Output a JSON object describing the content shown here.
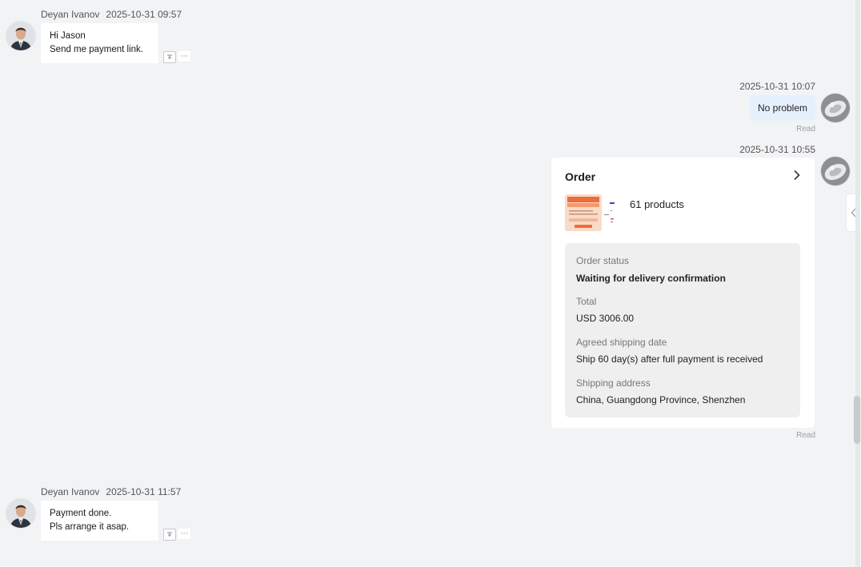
{
  "messages": [
    {
      "sender": "Deyan Ivanov",
      "time": "2025-10-31 09:57",
      "lines": [
        "Hi Jason",
        "Send me payment link."
      ]
    },
    {
      "time": "2025-10-31 10:07",
      "text": "No problem",
      "status": "Read"
    },
    {
      "time": "2025-10-31 10:55",
      "status": "Read",
      "order": {
        "title": "Order",
        "products": "61 products",
        "status_label": "Order status",
        "status_value": "Waiting for delivery confirmation",
        "total_label": "Total",
        "total_value": "USD 3006.00",
        "ship_date_label": "Agreed shipping date",
        "ship_date_value": "Ship 60 day(s) after full payment is received",
        "address_label": "Shipping address",
        "address_value": "China, Guangdong Province, Shenzhen"
      }
    },
    {
      "sender": "Deyan Ivanov",
      "time": "2025-10-31 11:57",
      "lines": [
        "Payment done.",
        "Pls arrange it asap."
      ]
    }
  ],
  "thumbnail": {
    "banner": "CUSTOM",
    "sub": "SILVER JEWELRY"
  },
  "colors": {
    "background": "#f2f3f5",
    "outgoing_bubble": "#e6f0fd",
    "incoming_bubble": "#ffffff"
  },
  "icons": {
    "reaction": "translate-icon",
    "more": "more-icon",
    "order_open": "chevron-right-icon",
    "side_panel": "chevron-left-icon"
  }
}
